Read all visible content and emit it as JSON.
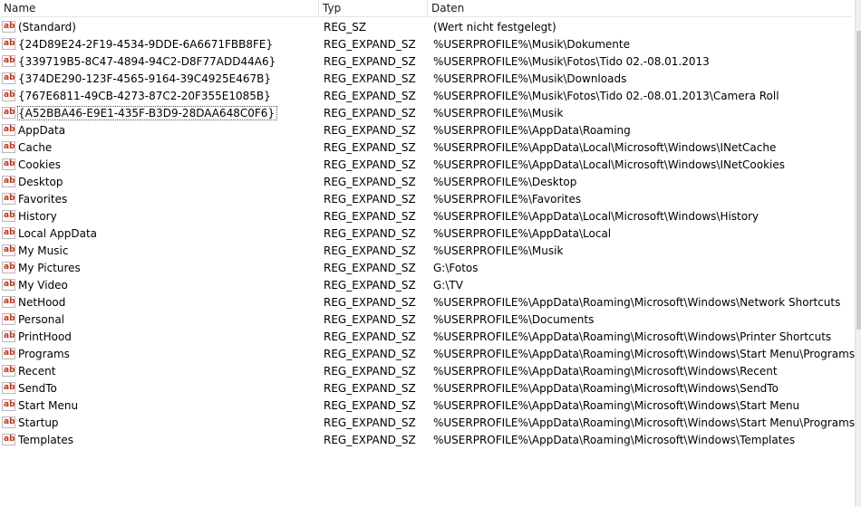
{
  "columns": {
    "name": "Name",
    "typ": "Typ",
    "daten": "Daten"
  },
  "icon": {
    "name": "reg-string-value-icon",
    "glyph": "ab",
    "color": "#c0301c"
  },
  "rows": [
    {
      "name": "(Standard)",
      "typ": "REG_SZ",
      "daten": "(Wert nicht festgelegt)"
    },
    {
      "name": "{24D89E24-2F19-4534-9DDE-6A6671FBB8FE}",
      "typ": "REG_EXPAND_SZ",
      "daten": "%USERPROFILE%\\Musik\\Dokumente"
    },
    {
      "name": "{339719B5-8C47-4894-94C2-D8F77ADD44A6}",
      "typ": "REG_EXPAND_SZ",
      "daten": "%USERPROFILE%\\Musik\\Fotos\\Tido 02.-08.01.2013"
    },
    {
      "name": "{374DE290-123F-4565-9164-39C4925E467B}",
      "typ": "REG_EXPAND_SZ",
      "daten": "%USERPROFILE%\\Musik\\Downloads"
    },
    {
      "name": "{767E6811-49CB-4273-87C2-20F355E1085B}",
      "typ": "REG_EXPAND_SZ",
      "daten": "%USERPROFILE%\\Musik\\Fotos\\Tido 02.-08.01.2013\\Camera Roll"
    },
    {
      "name": "{A52BBA46-E9E1-435F-B3D9-28DAA648C0F6}",
      "typ": "REG_EXPAND_SZ",
      "daten": "%USERPROFILE%\\Musik",
      "focused": true
    },
    {
      "name": "AppData",
      "typ": "REG_EXPAND_SZ",
      "daten": "%USERPROFILE%\\AppData\\Roaming"
    },
    {
      "name": "Cache",
      "typ": "REG_EXPAND_SZ",
      "daten": "%USERPROFILE%\\AppData\\Local\\Microsoft\\Windows\\INetCache"
    },
    {
      "name": "Cookies",
      "typ": "REG_EXPAND_SZ",
      "daten": "%USERPROFILE%\\AppData\\Local\\Microsoft\\Windows\\INetCookies"
    },
    {
      "name": "Desktop",
      "typ": "REG_EXPAND_SZ",
      "daten": "%USERPROFILE%\\Desktop"
    },
    {
      "name": "Favorites",
      "typ": "REG_EXPAND_SZ",
      "daten": "%USERPROFILE%\\Favorites"
    },
    {
      "name": "History",
      "typ": "REG_EXPAND_SZ",
      "daten": "%USERPROFILE%\\AppData\\Local\\Microsoft\\Windows\\History"
    },
    {
      "name": "Local AppData",
      "typ": "REG_EXPAND_SZ",
      "daten": "%USERPROFILE%\\AppData\\Local"
    },
    {
      "name": "My Music",
      "typ": "REG_EXPAND_SZ",
      "daten": "%USERPROFILE%\\Musik"
    },
    {
      "name": "My Pictures",
      "typ": "REG_EXPAND_SZ",
      "daten": "G:\\Fotos"
    },
    {
      "name": "My Video",
      "typ": "REG_EXPAND_SZ",
      "daten": "G:\\TV"
    },
    {
      "name": "NetHood",
      "typ": "REG_EXPAND_SZ",
      "daten": "%USERPROFILE%\\AppData\\Roaming\\Microsoft\\Windows\\Network Shortcuts"
    },
    {
      "name": "Personal",
      "typ": "REG_EXPAND_SZ",
      "daten": "%USERPROFILE%\\Documents"
    },
    {
      "name": "PrintHood",
      "typ": "REG_EXPAND_SZ",
      "daten": "%USERPROFILE%\\AppData\\Roaming\\Microsoft\\Windows\\Printer Shortcuts"
    },
    {
      "name": "Programs",
      "typ": "REG_EXPAND_SZ",
      "daten": "%USERPROFILE%\\AppData\\Roaming\\Microsoft\\Windows\\Start Menu\\Programs"
    },
    {
      "name": "Recent",
      "typ": "REG_EXPAND_SZ",
      "daten": "%USERPROFILE%\\AppData\\Roaming\\Microsoft\\Windows\\Recent"
    },
    {
      "name": "SendTo",
      "typ": "REG_EXPAND_SZ",
      "daten": "%USERPROFILE%\\AppData\\Roaming\\Microsoft\\Windows\\SendTo"
    },
    {
      "name": "Start Menu",
      "typ": "REG_EXPAND_SZ",
      "daten": "%USERPROFILE%\\AppData\\Roaming\\Microsoft\\Windows\\Start Menu"
    },
    {
      "name": "Startup",
      "typ": "REG_EXPAND_SZ",
      "daten": "%USERPROFILE%\\AppData\\Roaming\\Microsoft\\Windows\\Start Menu\\Programs\\Startup"
    },
    {
      "name": "Templates",
      "typ": "REG_EXPAND_SZ",
      "daten": "%USERPROFILE%\\AppData\\Roaming\\Microsoft\\Windows\\Templates"
    }
  ]
}
